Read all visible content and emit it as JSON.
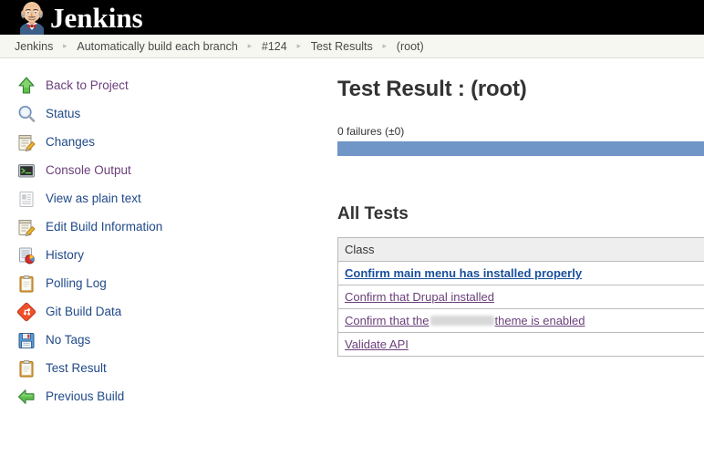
{
  "header": {
    "logo_icon": "jenkins-butler-icon",
    "wordmark": "Jenkins"
  },
  "breadcrumb": {
    "separator": "▸",
    "items": [
      {
        "label": "Jenkins"
      },
      {
        "label": "Automatically build each branch"
      },
      {
        "label": "#124"
      },
      {
        "label": "Test Results"
      },
      {
        "label": "(root)"
      }
    ]
  },
  "sidebar": {
    "items": [
      {
        "label": "Back to Project",
        "icon": "green-up-arrow-icon",
        "visited": true
      },
      {
        "label": "Status",
        "icon": "magnifier-icon",
        "visited": false
      },
      {
        "label": "Changes",
        "icon": "notepad-pencil-icon",
        "visited": false
      },
      {
        "label": "Console Output",
        "icon": "terminal-icon",
        "visited": true
      },
      {
        "label": "View as plain text",
        "icon": "document-icon",
        "visited": false
      },
      {
        "label": "Edit Build Information",
        "icon": "notepad-pencil-icon",
        "visited": false
      },
      {
        "label": "History",
        "icon": "history-chart-icon",
        "visited": false
      },
      {
        "label": "Polling Log",
        "icon": "clipboard-icon",
        "visited": false
      },
      {
        "label": "Git Build Data",
        "icon": "git-diamond-icon",
        "visited": false
      },
      {
        "label": "No Tags",
        "icon": "floppy-disk-icon",
        "visited": false
      },
      {
        "label": "Test Result",
        "icon": "clipboard-icon",
        "visited": false
      },
      {
        "label": "Previous Build",
        "icon": "green-left-arrow-icon",
        "visited": false
      }
    ]
  },
  "main": {
    "page_title": "Test Result : (root)",
    "failure_summary": "0 failures (±0)",
    "progress_percent": 100,
    "progress_color": "#7096c8",
    "all_tests_heading": "All Tests",
    "table": {
      "columns": [
        "Class"
      ],
      "rows": [
        {
          "label": "Confirm main menu has installed properly",
          "visited": false,
          "redacted": false
        },
        {
          "label": "Confirm that Drupal installed",
          "visited": true,
          "redacted": false
        },
        {
          "label_prefix": "Confirm that the",
          "label_suffix": "theme is enabled",
          "visited": true,
          "redacted": true
        },
        {
          "label": "Validate API",
          "visited": true,
          "redacted": false
        }
      ]
    }
  }
}
